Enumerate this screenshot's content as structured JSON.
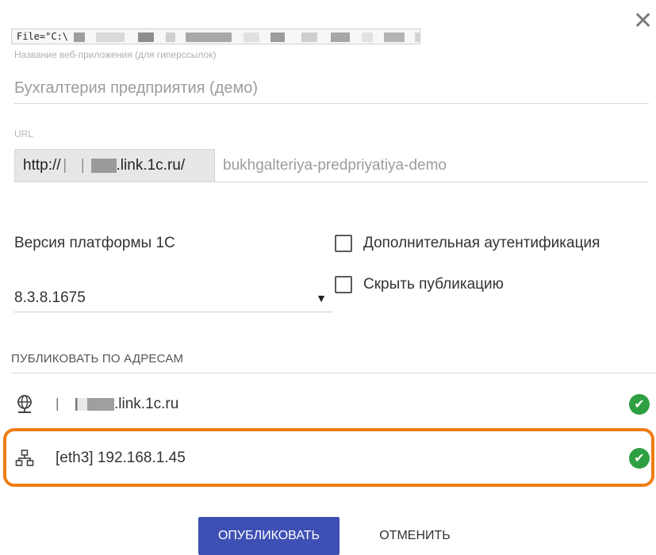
{
  "dialog": {
    "close_glyph": "✕"
  },
  "file": {
    "prefix": "File=\"C:\\",
    "suffix": ";"
  },
  "name": {
    "hint": "Название веб-приложения (для гиперссылок)",
    "value": "Бухгалтерия предприятия (демо)"
  },
  "url": {
    "label": "URL",
    "prefix": "http://",
    "domain": ".link.1c.ru/",
    "path": "bukhgalteriya-predpriyatiya-demo"
  },
  "platform": {
    "label": "Версия платформы 1С",
    "selected": "8.3.8.1675",
    "caret": "▼"
  },
  "options": {
    "extra_auth": "Дополнительная аутентификация",
    "hide_publication": "Скрыть публикацию"
  },
  "publish_section": {
    "title": "ПУБЛИКОВАТЬ ПО АДРЕСАМ",
    "addresses": [
      {
        "icon": "globe-icon",
        "text": ".link.1c.ru",
        "status": "ok"
      },
      {
        "icon": "network-icon",
        "text": "[eth3] 192.168.1.45",
        "status": "ok"
      }
    ],
    "check_glyph": "✔"
  },
  "buttons": {
    "publish": "ОПУБЛИКОВАТЬ",
    "cancel": "ОТМЕНИТЬ"
  },
  "colors": {
    "primary": "#3e50b4",
    "success": "#2ea043",
    "highlight": "#f07d12"
  }
}
